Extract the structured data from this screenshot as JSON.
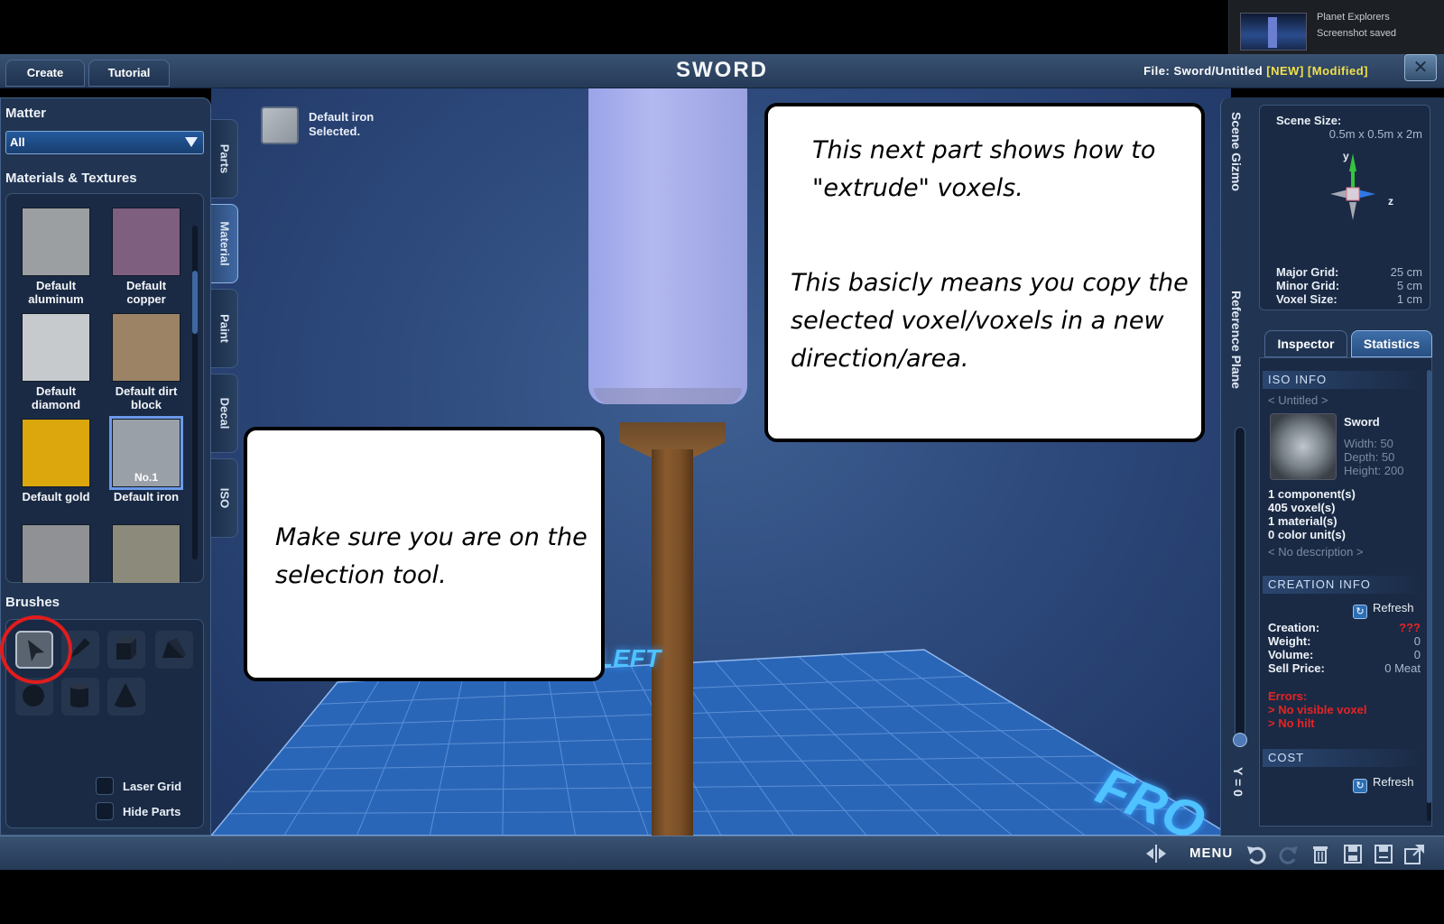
{
  "notice": {
    "app": "Planet Explorers",
    "message": "Screenshot saved"
  },
  "header": {
    "tabs": [
      "Create",
      "Tutorial"
    ],
    "title": "SWORD",
    "file_label": "File:",
    "file_path": "Sword/Untitled",
    "tag_new": "[NEW]",
    "tag_modified": "[Modified]",
    "close_glyph": "✕"
  },
  "left": {
    "matter_heading": "Matter",
    "matter_value": "All",
    "materials_heading": "Materials & Textures",
    "materials": [
      {
        "line1": "Default",
        "line2": "aluminum",
        "color": "#9c9fa2"
      },
      {
        "line1": "Default",
        "line2": "copper",
        "color": "#7e5f7f"
      },
      {
        "line1": "Default",
        "line2": "diamond",
        "color": "#c7cacd"
      },
      {
        "line1": "Default dirt",
        "line2": "block",
        "color": "#9c8366"
      },
      {
        "line1": "Default gold",
        "line2": "",
        "color": "#dba70c"
      },
      {
        "line1": "Default iron",
        "line2": "",
        "color": "#9aa0a8",
        "badge": "No.1",
        "selected": true
      },
      {
        "line1": "",
        "line2": "",
        "color": "#8f9194"
      },
      {
        "line1": "",
        "line2": "",
        "color": "#8c8a7a"
      }
    ],
    "vertical_tabs": [
      "Parts",
      "Material",
      "Paint",
      "Decal",
      "ISO"
    ],
    "brushes_heading": "Brushes",
    "brushes": [
      "select-icon",
      "pencil-icon",
      "box-icon",
      "wedge-icon",
      "sphere-icon",
      "cylinder-icon",
      "cone-icon"
    ],
    "laser_grid": "Laser Grid",
    "hide_parts": "Hide Parts"
  },
  "viewport": {
    "selected_line1": "Default iron",
    "selected_line2": "Selected.",
    "floor_left": "LEFT",
    "floor_front": "FRO"
  },
  "callouts": {
    "extrude_p1": "This next part shows how to \"extrude\" voxels.",
    "extrude_p2": "This basicly means you copy the selected voxel/voxels in a new direction/area.",
    "select_p1": "Make sure you are on the selection tool."
  },
  "right": {
    "scene_gizmo": "Scene Gizmo",
    "reference_plane": "Reference Plane",
    "y_value": "Y = 0",
    "scene_size_label": "Scene Size:",
    "scene_size_value": "0.5m x 0.5m x 2m",
    "axis_y": "y",
    "axis_z": "z",
    "major_grid_label": "Major Grid:",
    "major_grid_value": "25 cm",
    "minor_grid_label": "Minor Grid:",
    "minor_grid_value": "5 cm",
    "voxel_size_label": "Voxel Size:",
    "voxel_size_value": "1 cm",
    "tabs": [
      "Inspector",
      "Statistics"
    ],
    "iso_info": "ISO INFO",
    "untitled": "< Untitled >",
    "iso_name": "Sword",
    "width": "Width: 50",
    "depth": "Depth: 50",
    "height": "Height: 200",
    "components": "1 component(s)",
    "voxels": "405 voxel(s)",
    "materials_count": "1 material(s)",
    "color_units": "0 color unit(s)",
    "no_description": "< No description >",
    "creation_info": "CREATION INFO",
    "refresh": "Refresh",
    "creation_label": "Creation:",
    "creation_value": "???",
    "weight_label": "Weight:",
    "weight_value": "0",
    "volume_label": "Volume:",
    "volume_value": "0",
    "sell_label": "Sell Price:",
    "sell_value": "0 Meat",
    "errors_label": "Errors:",
    "error1": "> No visible voxel",
    "error2": "> No hilt",
    "cost": "COST"
  },
  "bottom": {
    "menu": "MENU"
  }
}
